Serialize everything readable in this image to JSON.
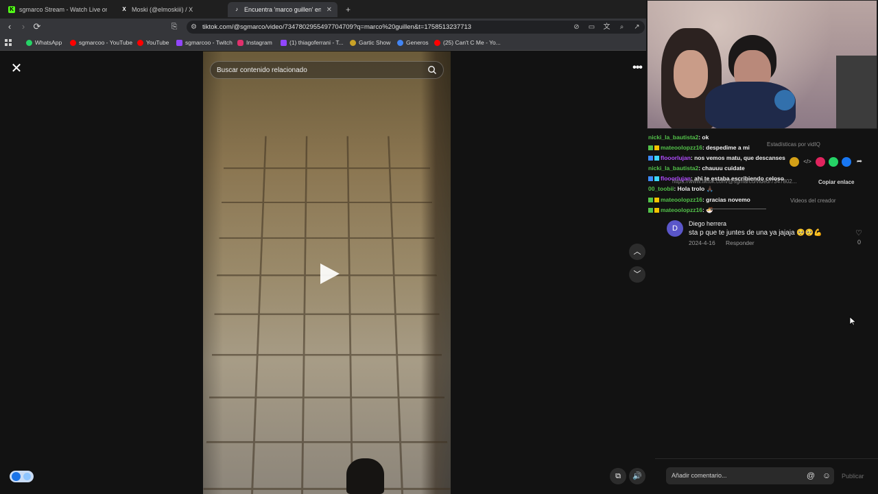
{
  "tabs": [
    {
      "title": "sgmarco Stream - Watch Live on Kick",
      "favicon": "K",
      "favicon_color": "#53fc18"
    },
    {
      "title": "Moski (@elmoskiii) / X",
      "favicon": "X",
      "favicon_color": "#ffffff"
    },
    {
      "title": "Encuentra 'marco guillen' en TikTok",
      "favicon": "T",
      "favicon_color": "#ffffff"
    }
  ],
  "new_tab_label": "+",
  "url": "tiktok.com/@sgmarco/video/7347802955497704709?q=marco%20guillen&t=1758513237713",
  "bookmarks": [
    {
      "label": "WhatsApp",
      "color": "#25d366"
    },
    {
      "label": "sgmarcoo - YouTube",
      "color": "#ff0000"
    },
    {
      "label": "YouTube",
      "color": "#ff0000"
    },
    {
      "label": "sgmarcoo - Twitch",
      "color": "#9146ff"
    },
    {
      "label": "Instagram",
      "color": "#e1306c"
    },
    {
      "label": "(1) thiagoferrani - T...",
      "color": "#9146ff"
    },
    {
      "label": "Gartic Show",
      "color": "#c9a227"
    },
    {
      "label": "Generos",
      "color": "#4285f4"
    },
    {
      "label": "(25) Can't C Me - Yo...",
      "color": "#ff0000"
    }
  ],
  "video": {
    "search_placeholder": "Buscar contenido relacionado"
  },
  "chat": [
    {
      "user": "nicki_la_bautista2",
      "msg": ": ok",
      "user_color": "#53c24a",
      "badges": []
    },
    {
      "user": "mateoolopzz16",
      "msg": ": despedime a mi",
      "user_color": "#53c24a",
      "badges": [
        "#53c24a",
        "#f2c300"
      ]
    },
    {
      "user": "flooorlujan",
      "msg": ": nos vemos matu, que descanses",
      "user_color": "#b14cff",
      "badges": [
        "#3d8bff",
        "#3dd6ff"
      ]
    },
    {
      "user": "nicki_la_bautista2",
      "msg": ": chauuu cuidate",
      "user_color": "#53c24a",
      "badges": []
    },
    {
      "user": "flooorlujan",
      "msg": ": ahi te estaba escribiendo celoso",
      "user_color": "#b14cff",
      "badges": [
        "#3d8bff",
        "#3dd6ff"
      ]
    },
    {
      "user": "00_toobii",
      "msg": ": Hola trolo 🙏🏿",
      "user_color": "#53c24a",
      "badges": []
    },
    {
      "user": "mateoolopzz16",
      "msg": ": gracias novemo",
      "user_color": "#53c24a",
      "badges": [
        "#53c24a",
        "#f2c300"
      ]
    },
    {
      "user": "mateoolopzz16",
      "msg": ": 🍜",
      "user_color": "#53c24a",
      "badges": [
        "#53c24a",
        "#f2c300"
      ]
    }
  ],
  "underlay": {
    "stats_label": "Estadísticas por vidIQ",
    "copy_link": "Copiar enlace",
    "creator_videos": "Videos del creador",
    "link_text": "https://www.tiktok.com/@sgmarco/video/7347802..."
  },
  "comment": {
    "avatar_letter": "D",
    "user": "Diego herrera",
    "text": "sta p que te juntes de una ya jajaja 🥺🥺💪",
    "date": "2024-4-16",
    "reply": "Responder",
    "likes": "0"
  },
  "comment_bar": {
    "placeholder": "Añadir comentario...",
    "publish": "Publicar"
  }
}
